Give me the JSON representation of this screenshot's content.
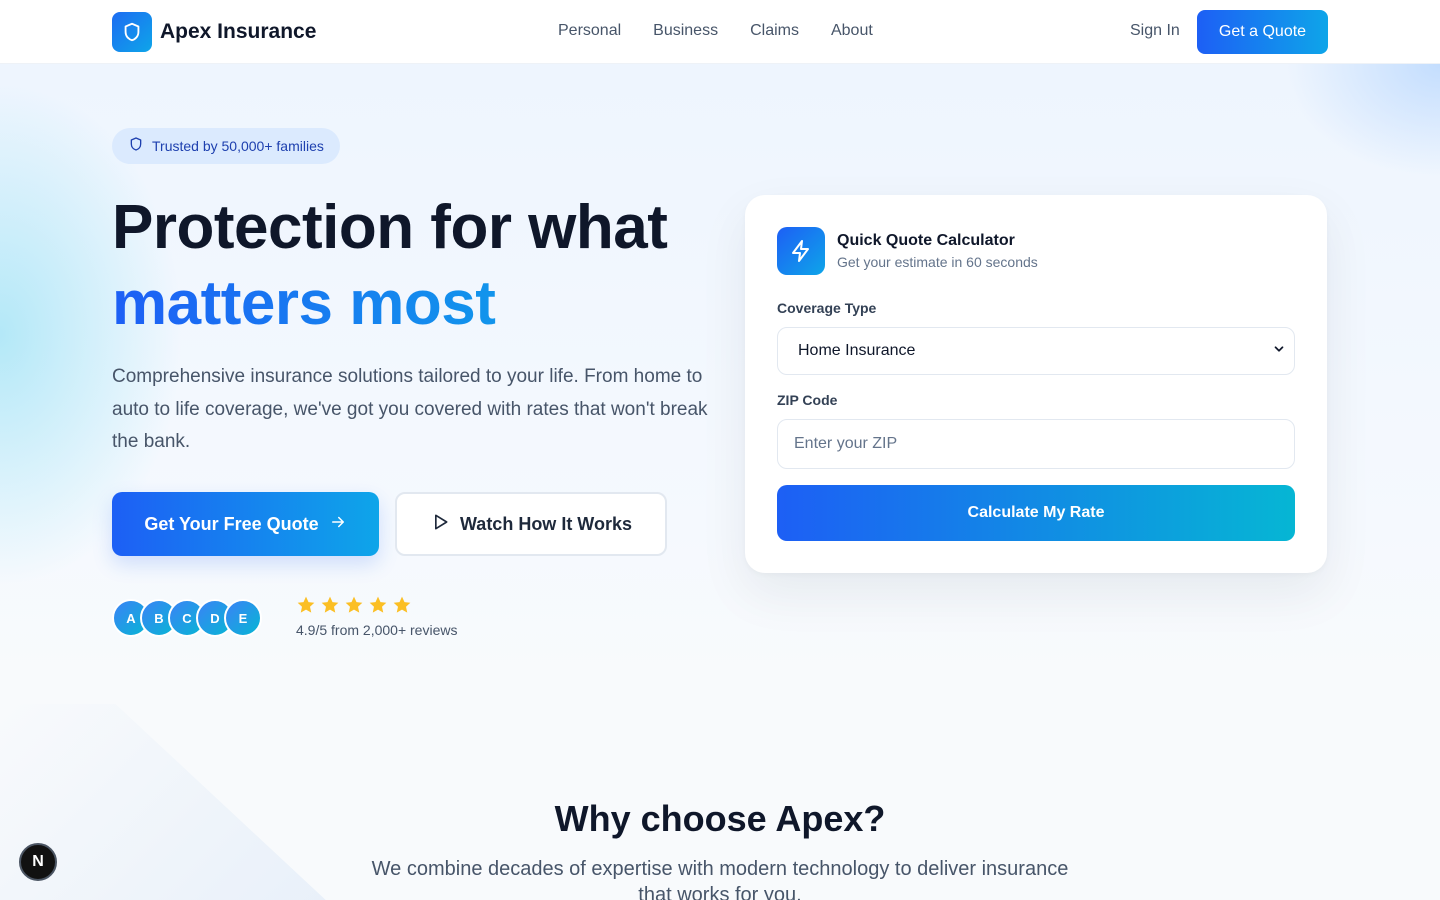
{
  "brand": {
    "name": "Apex Insurance",
    "accent": "#1d5ff5",
    "accent_end": "#0ea5e9"
  },
  "nav": {
    "links": [
      "Personal",
      "Business",
      "Claims",
      "About"
    ],
    "sign_in": "Sign In",
    "cta": "Get a Quote"
  },
  "hero": {
    "badge": "Trusted by 50,000+ families",
    "title_line1": "Protection for what",
    "title_line2": "matters most",
    "lead": "Comprehensive insurance solutions tailored to your life. From home to auto to life coverage, we've got you covered with rates that won't break the bank.",
    "primary_cta": "Get Your Free Quote",
    "secondary_cta": "Watch How It Works",
    "avatars": [
      "A",
      "B",
      "C",
      "D",
      "E"
    ],
    "rating_stars": 5,
    "reviews_text": "4.9/5 from 2,000+ reviews"
  },
  "quote_card": {
    "title": "Quick Quote Calculator",
    "subtitle": "Get your estimate in 60 seconds",
    "coverage_label": "Coverage Type",
    "coverage_value": "Home Insurance",
    "zip_label": "ZIP Code",
    "zip_placeholder": "Enter your ZIP",
    "zip_value": "",
    "submit": "Calculate My Rate"
  },
  "why": {
    "title": "Why choose Apex?",
    "subtitle": "We combine decades of expertise with modern technology to deliver insurance that works for you."
  },
  "dev_badge": {
    "letter": "N"
  }
}
